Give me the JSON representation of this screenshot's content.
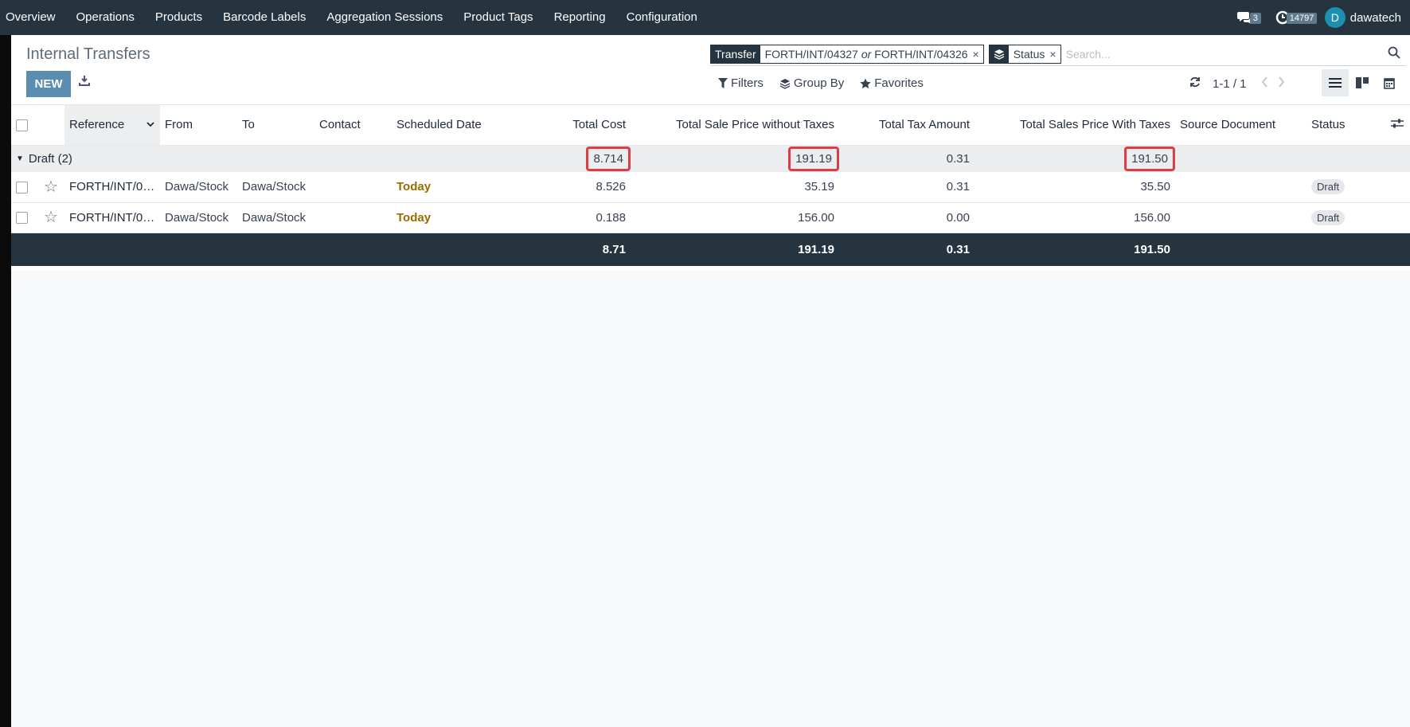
{
  "topnav": {
    "menu": [
      "Overview",
      "Operations",
      "Products",
      "Barcode Labels",
      "Aggregation Sessions",
      "Product Tags",
      "Reporting",
      "Configuration"
    ],
    "messages_badge": "3",
    "activity_badge": "14797",
    "user_initial": "D",
    "user_name": "dawatech"
  },
  "page": {
    "title": "Internal Transfers",
    "new_label": "NEW"
  },
  "search": {
    "facet1_label": "Transfer",
    "facet1_value_a": "FORTH/INT/04327",
    "facet1_or": "or",
    "facet1_value_b": "FORTH/INT/04326",
    "facet2_label": "Status",
    "placeholder": "Search..."
  },
  "filters": {
    "filters_label": "Filters",
    "groupby_label": "Group By",
    "favorites_label": "Favorites"
  },
  "pager": {
    "value": "1-1 / 1"
  },
  "table": {
    "headers": {
      "reference": "Reference",
      "from": "From",
      "to": "To",
      "contact": "Contact",
      "scheduled_date": "Scheduled Date",
      "total_cost": "Total Cost",
      "sale_wo_tax": "Total Sale Price without Taxes",
      "tax": "Total Tax Amount",
      "sale_w_tax": "Total Sales Price With Taxes",
      "source_doc": "Source Document",
      "status": "Status"
    },
    "group": {
      "label": "Draft (2)",
      "total_cost": "8.714",
      "sale_wo_tax": "191.19",
      "tax": "0.31",
      "sale_w_tax": "191.50"
    },
    "rows": [
      {
        "reference": "FORTH/INT/04...",
        "from": "Dawa/Stock",
        "to": "Dawa/Stock",
        "contact": "",
        "scheduled_date": "Today",
        "total_cost": "8.526",
        "sale_wo_tax": "35.19",
        "tax": "0.31",
        "sale_w_tax": "35.50",
        "source_doc": "",
        "status": "Draft"
      },
      {
        "reference": "FORTH/INT/04...",
        "from": "Dawa/Stock",
        "to": "Dawa/Stock",
        "contact": "",
        "scheduled_date": "Today",
        "total_cost": "0.188",
        "sale_wo_tax": "156.00",
        "tax": "0.00",
        "sale_w_tax": "156.00",
        "source_doc": "",
        "status": "Draft"
      }
    ],
    "footer": {
      "total_cost": "8.71",
      "sale_wo_tax": "191.19",
      "tax": "0.31",
      "sale_w_tax": "191.50"
    }
  },
  "colors": {
    "navbar": "#25343f",
    "primary_button": "#5b8db0",
    "highlight_box": "#e03c45",
    "today_text": "#9a6b00"
  }
}
